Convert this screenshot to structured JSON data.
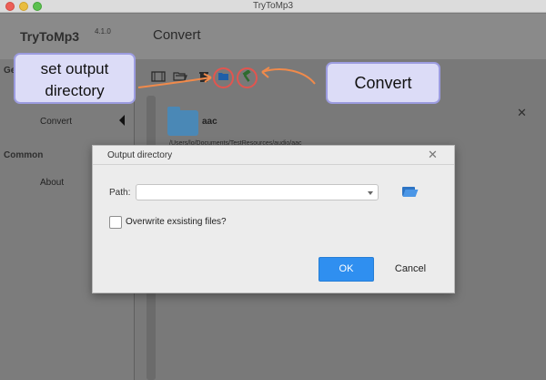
{
  "window": {
    "title": "TryToMp3"
  },
  "header": {
    "app_name": "TryToMp3",
    "version": "4.1.0",
    "section_title": "Convert"
  },
  "sidebar": {
    "section_general_partial": "Ge",
    "item_convert": "Convert",
    "section_common": "Common",
    "item_about": "About"
  },
  "main": {
    "toolbar_icons": [
      "film-icon",
      "open-folder-icon",
      "trash-icon",
      "output-folder-icon",
      "hammer-icon"
    ],
    "item_name": "aac",
    "item_path": "/Users/lo/Documents/TestResources/audio/aac"
  },
  "annotations": {
    "set_output_directory": "set output directory",
    "convert": "Convert",
    "callout_color": "#dcdcf7",
    "arrow_color": "#f08a4b",
    "highlight_color": "#e2554f"
  },
  "dialog": {
    "title": "Output directory",
    "path_label": "Path:",
    "path_value": "",
    "overwrite_label": "Overwrite exsisting files?",
    "overwrite_checked": false,
    "ok_label": "OK",
    "cancel_label": "Cancel"
  },
  "colors": {
    "accent": "#2f8ff0"
  }
}
